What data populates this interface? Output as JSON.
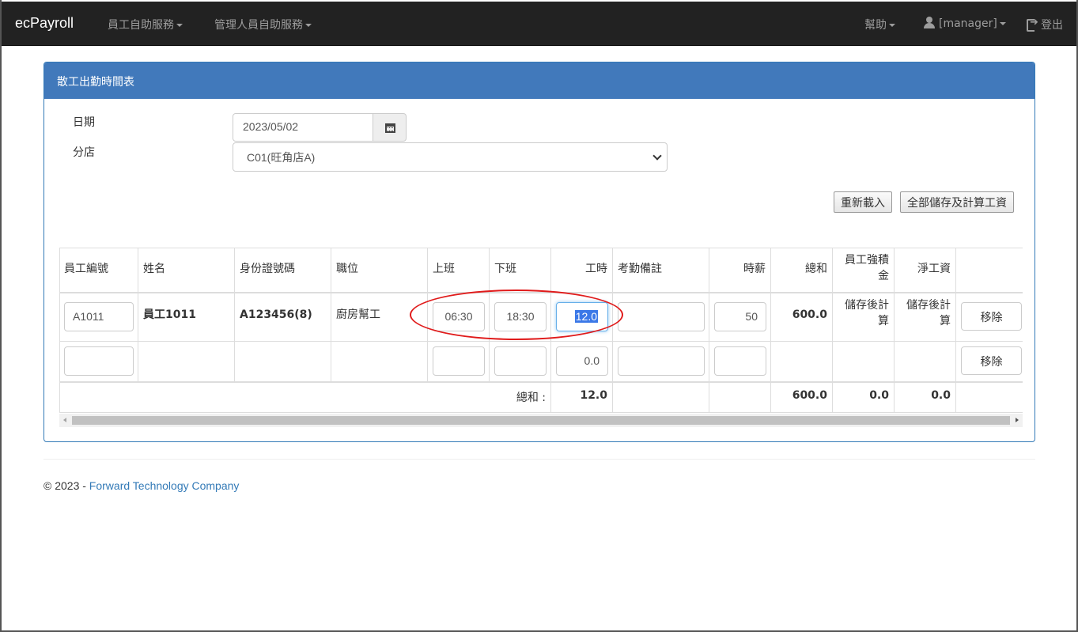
{
  "navbar": {
    "brand": "ecPayroll",
    "menu_employee": "員工自助服務",
    "menu_manager": "管理人員自助服務",
    "help": "幫助",
    "user": "[manager]",
    "logout": "登出"
  },
  "panel": {
    "title": "散工出勤時間表",
    "date_label": "日期",
    "date_value": "2023/05/02",
    "branch_label": "分店",
    "branch_value": "C01(旺角店A)",
    "reload_button": "重新載入",
    "save_all_button": "全部儲存及計算工資"
  },
  "table": {
    "headers": {
      "emp_no": "員工編號",
      "name": "姓名",
      "id_no": "身份證號碼",
      "position": "職位",
      "start": "上班",
      "end": "下班",
      "hours": "工時",
      "remark": "考勤備註",
      "rate": "時薪",
      "total": "總和",
      "mpf_line1": "員工強積",
      "mpf_line2": "金",
      "net": "淨工資"
    },
    "rows": [
      {
        "emp_no": "A1011",
        "name_prefix": "員工",
        "name_num": "1011",
        "id_no": "A123456(8)",
        "position": "廚房幫工",
        "start": "06:30",
        "end": "18:30",
        "hours": "12.0",
        "remark": "",
        "rate": "50",
        "total": "600.0",
        "mpf_line1": "儲存後計",
        "mpf_line2": "算",
        "net_line1": "儲存後計",
        "net_line2": "算",
        "remove": "移除"
      },
      {
        "emp_no": "",
        "start": "",
        "end": "",
        "hours": "0.0",
        "remark": "",
        "rate": "",
        "remove": "移除"
      }
    ],
    "summary": {
      "label": "總和 :",
      "hours": "12.0",
      "total": "600.0",
      "mpf": "0.0",
      "net": "0.0"
    }
  },
  "footer": {
    "prefix": "© 2023 - ",
    "company": "Forward Technology Company"
  },
  "colors": {
    "navbar_bg": "#222222",
    "panel_header": "#4179bb",
    "link": "#337ab7",
    "annotation": "#e01b1b"
  }
}
